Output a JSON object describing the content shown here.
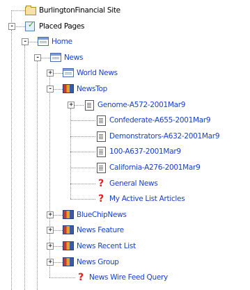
{
  "tree": {
    "nodes": [
      {
        "label": "BurlingtonFinancial Site",
        "icon": "folder-icon",
        "expander": "none",
        "color": "black"
      },
      {
        "label": "Placed Pages",
        "icon": "placed-pages-icon",
        "expander": "-",
        "color": "black"
      },
      {
        "label": "Home",
        "icon": "page-icon",
        "expander": "-",
        "color": "blue"
      },
      {
        "label": "News",
        "icon": "page-icon",
        "expander": "-",
        "color": "blue"
      },
      {
        "label": "World News",
        "icon": "page-icon",
        "expander": "+",
        "color": "blue"
      },
      {
        "label": "NewsTop",
        "icon": "list-icon",
        "expander": "-",
        "color": "blue"
      },
      {
        "label": "Genome-A572-2001Mar9",
        "icon": "document-icon",
        "expander": "+",
        "color": "blue"
      },
      {
        "label": "Confederate-A655-2001Mar9",
        "icon": "document-icon",
        "expander": "none",
        "color": "blue"
      },
      {
        "label": "Demonstrators-A632-2001Mar9",
        "icon": "document-icon",
        "expander": "none",
        "color": "blue"
      },
      {
        "label": "100-A637-2001Mar9",
        "icon": "document-icon",
        "expander": "none",
        "color": "blue"
      },
      {
        "label": "California-A276-2001Mar9",
        "icon": "document-icon",
        "expander": "none",
        "color": "blue"
      },
      {
        "label": "General News",
        "icon": "question-icon",
        "expander": "none",
        "color": "blue"
      },
      {
        "label": "My Active List Articles",
        "icon": "question-icon",
        "expander": "none",
        "color": "blue"
      },
      {
        "label": "BlueChipNews",
        "icon": "list-icon",
        "expander": "+",
        "color": "blue"
      },
      {
        "label": "News Feature",
        "icon": "list-icon",
        "expander": "+",
        "color": "blue"
      },
      {
        "label": "News Recent List",
        "icon": "list-icon",
        "expander": "+",
        "color": "blue"
      },
      {
        "label": "News Group",
        "icon": "list-icon",
        "expander": "+",
        "color": "blue"
      },
      {
        "label": "News Wire Feed Query",
        "icon": "question-icon",
        "expander": "none",
        "color": "blue"
      }
    ],
    "colors": {
      "link": "#1a40c8",
      "text": "#000000",
      "connector": "#8a8a8a"
    }
  }
}
